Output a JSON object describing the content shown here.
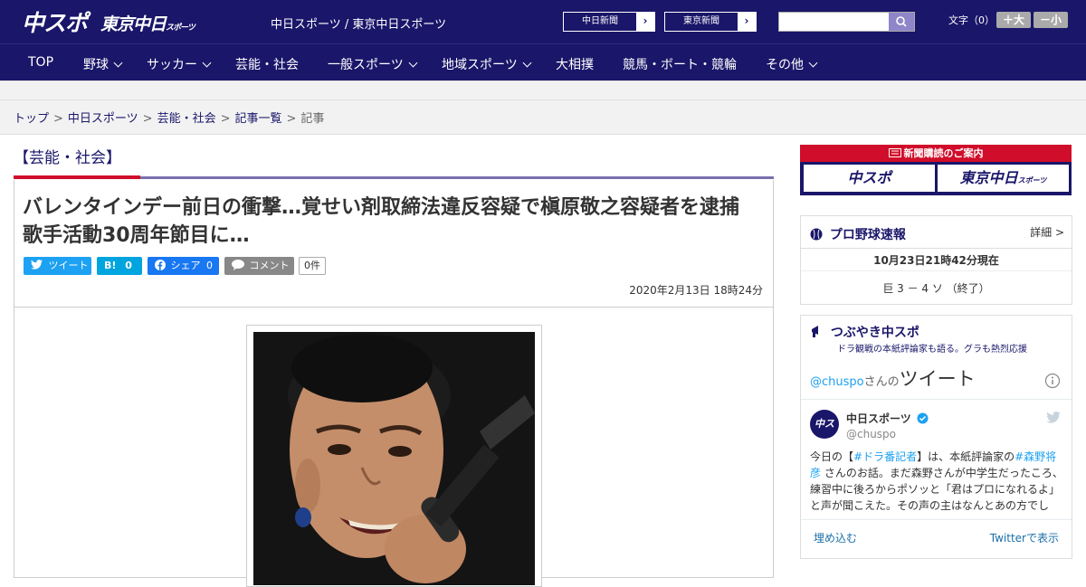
{
  "header": {
    "logo_main": "中スポ",
    "logo_sub": "東京中日",
    "logo_sub_small": "スポーツ",
    "site_link_1": "中日スポーツ",
    "site_link_sep": " / ",
    "site_link_2": "東京中日スポーツ",
    "btn_chunichi": "中日新聞",
    "btn_tokyo": "東京新聞",
    "search_placeholder": "",
    "font_size_label": "文字（0）",
    "font_bigger": "＋大",
    "font_smaller": "－小"
  },
  "nav": {
    "items": [
      "TOP",
      "野球",
      "サッカー",
      "芸能・社会",
      "一般スポーツ",
      "地域スポーツ",
      "大相撲",
      "競馬・ボート・競輪",
      "その他"
    ]
  },
  "breadcrumb": {
    "items": [
      "トップ",
      "中日スポーツ",
      "芸能・社会",
      "記事一覧"
    ],
    "current": "記事",
    "sep": ">"
  },
  "article": {
    "category": "【芸能・社会】",
    "title_line1": "バレンタインデー前日の衝撃…覚せい剤取締法違反容疑で槇原敬之容疑者を逮捕",
    "title_line2": "歌手活動30周年節目に…",
    "tweet_label": "ツイート",
    "hatena_label": "B!",
    "hatena_count": "0",
    "facebook_label": "シェア",
    "facebook_count": "0",
    "comment_label": "コメント",
    "comment_count": "0件",
    "date": "2020年2月13日 18時24分"
  },
  "sidebar": {
    "subscribe_title": "新聞購読のご案内",
    "subscribe_btn1": "中スポ",
    "subscribe_btn2": "東京中日",
    "subscribe_btn2_small": "スポーツ",
    "baseball_title": "プロ野球速報",
    "baseball_detail": "詳細 >",
    "baseball_time": "10月23日21時42分現在",
    "baseball_score": "巨 3 － 4 ソ （終了）",
    "tsubuyaki_title": "つぶやき中スポ",
    "tsubuyaki_sub": "ドラ観戦の本紙評論家も語る。グラも熱烈応援",
    "tweets_handle": "@chuspo",
    "tweets_suffix": "さんの",
    "tweets_title": "ツイート",
    "tw_user": "中日スポーツ",
    "tw_screen": "@chuspo",
    "tw_text_1": "今日の【",
    "tw_hashtag_1": "#ドラ番記者",
    "tw_text_2": "】は、本紙評論家の",
    "tw_hashtag_2": "#森野将彦",
    "tw_text_3": " さんのお話。まだ森野さんが中学生だったころ、練習中に後ろからポソッと「君はプロになれるよ」と声が聞こえた。その声の主はなんとあの方でし",
    "embed_label": "埋め込む",
    "view_on_twitter": "Twitterで表示"
  },
  "colors": {
    "navy": "#1a1669",
    "red": "#d00d2a",
    "twitter": "#1da1f2",
    "facebook": "#1877f2",
    "hatena": "#00a4de"
  }
}
